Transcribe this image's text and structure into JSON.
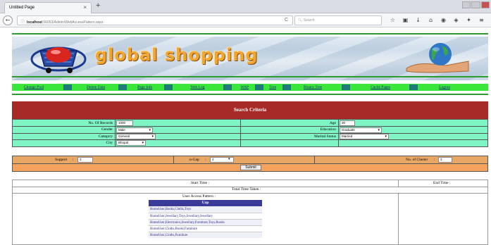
{
  "browser": {
    "tab_title": "Untitled Page",
    "tab_close": "×",
    "new_tab": "+",
    "url_host": "localhost",
    "url_rest": ":56053/Admin/WebAccessPattern.aspx",
    "search_placeholder": "Search",
    "reload_glyph": "C",
    "toolbar_icons": [
      "star-icon",
      "reader-icon",
      "download-icon",
      "home-icon",
      "pocket-icon",
      "shield-icon",
      "extension-icon",
      "menu-icon"
    ]
  },
  "site": {
    "brand": "global shopping",
    "menu": [
      "Change Pwd",
      "Delete Data",
      "Page Info",
      "Web Log",
      "WAP",
      "Tree",
      "Binary Tree",
      "Cache Pages",
      "Logout"
    ]
  },
  "criteria": {
    "title": "Search Criteria",
    "records_label": "No. Of Records",
    "records_value": "1000",
    "age_label": "Age",
    "age_value": "30",
    "gender_label": "Gender",
    "gender_value": "Male",
    "education_label": "Education",
    "education_value": "Graduate",
    "category_label": "Category",
    "category_value": "General",
    "marital_label": "Marital Status",
    "marital_value": "Married",
    "city_label": "City",
    "city_value": "Bhopal",
    "support_label": "Support",
    "support_value": "3",
    "ngap_label": "n-Gap",
    "ngap_value": "2",
    "cluster_label": "No. of Cluster",
    "cluster_value": "3",
    "submit_label": "Submit"
  },
  "results": {
    "start_time": "Start Time :",
    "end_time": "End Time :",
    "total_time": "Total Time Taken :",
    "pattern_label": "User Access Pattern :",
    "pattern_header": "Uap",
    "patterns": [
      "HomeUser,Books,Cloths,Toys",
      "HomeUser,Jewellary,Toys,Jewellary,Jewellary",
      "HomeUser,Electronics,Jewellary,Furniture,Toys,Books",
      "HomeUser,Cloths,Books,Furniture",
      "HomeUser,Cloths,Furniture"
    ]
  },
  "colors": {
    "menu_green": "#39e639",
    "criteria_header": "#a82a27",
    "criteria_bg": "#7ff5c6",
    "support_bg": "#e9a766",
    "pattern_header": "#3a3a9a"
  }
}
